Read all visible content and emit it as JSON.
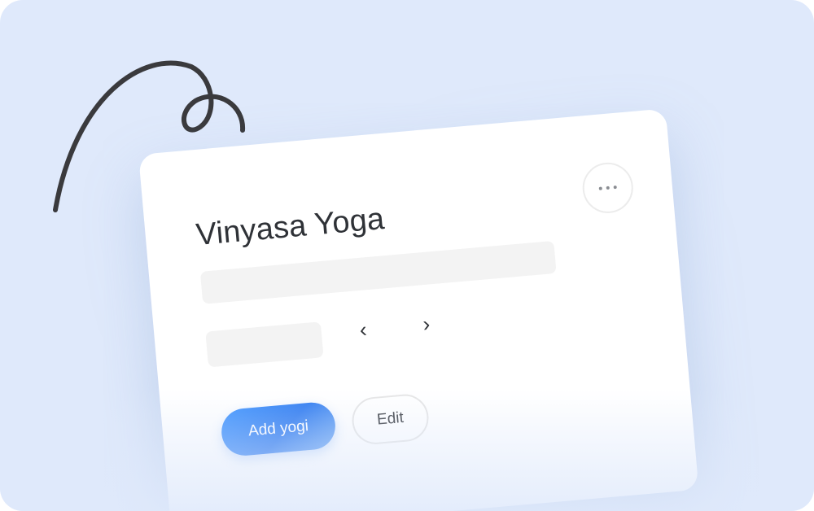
{
  "card": {
    "title": "Vinyasa Yoga",
    "more_button_icon": "more-horizontal-icon",
    "nav": {
      "prev_icon": "chevron-left-icon",
      "next_icon": "chevron-right-icon",
      "prev_glyph": "‹",
      "next_glyph": "›"
    },
    "primary_button_label": "Add yogi",
    "secondary_button_label": "Edit"
  },
  "colors": {
    "background": "#dfe9fb",
    "card": "#ffffff",
    "accent": "#2f7bf0",
    "text": "#2f3237",
    "squiggle": "#3a3a3d"
  }
}
